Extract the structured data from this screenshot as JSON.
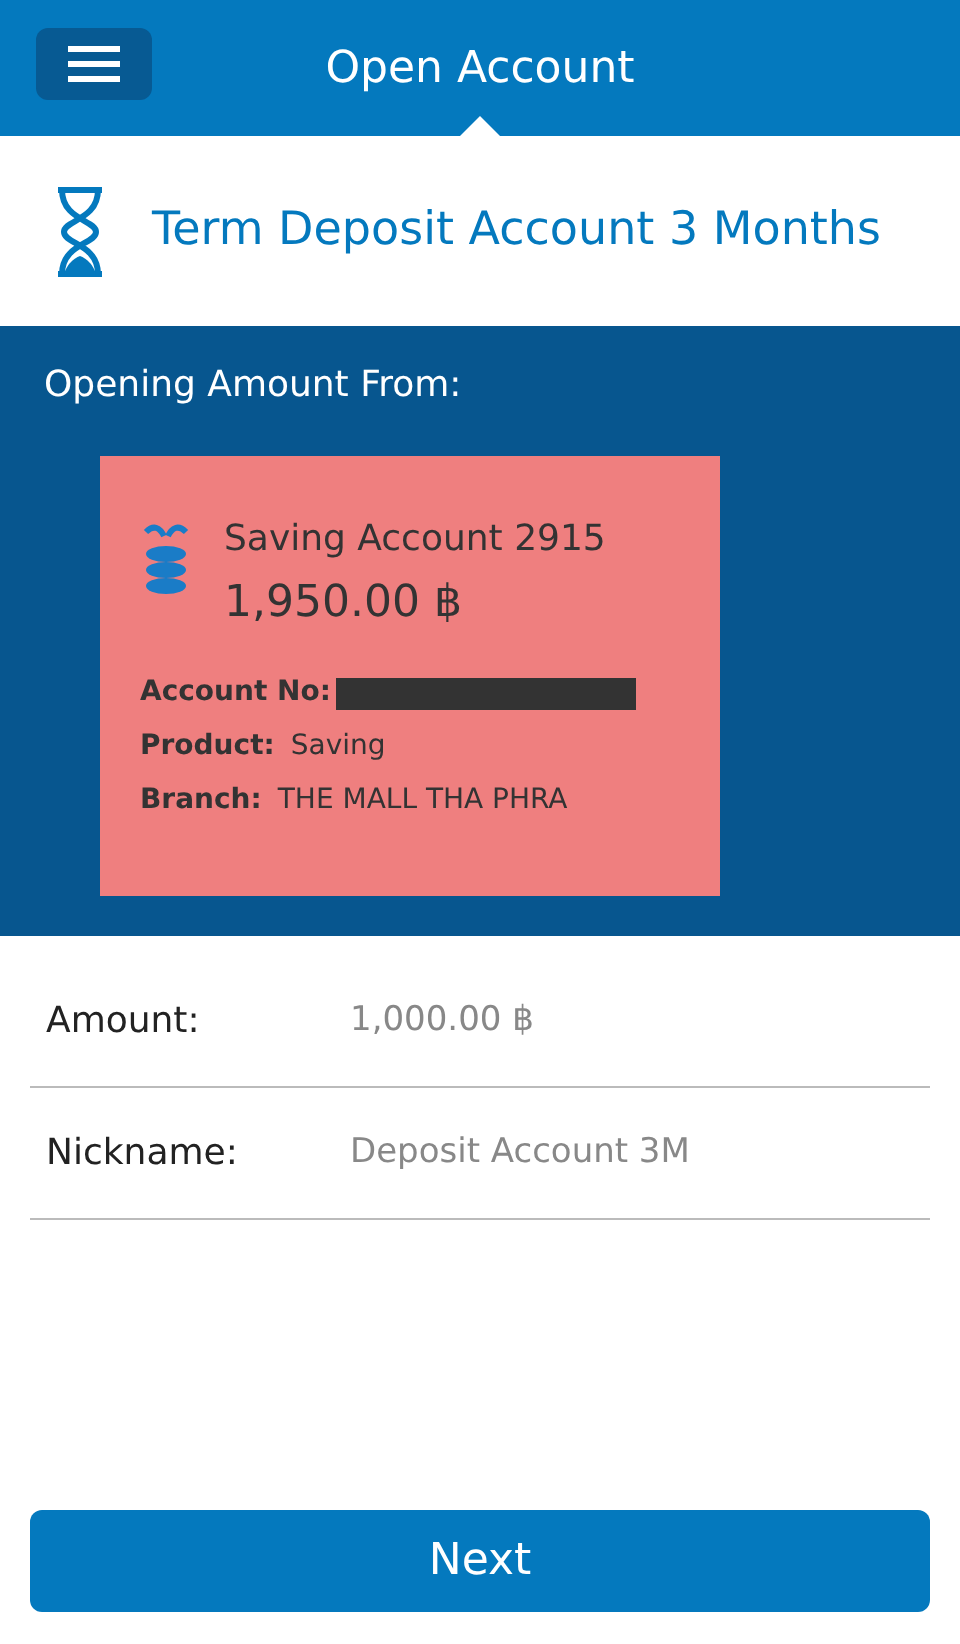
{
  "header": {
    "title": "Open Account"
  },
  "product": {
    "title": "Term Deposit Account 3 Months"
  },
  "source": {
    "label": "Opening Amount From:",
    "account": {
      "name": "Saving Account 2915",
      "balance": "1,950.00 ฿",
      "account_no_label": "Account No:",
      "account_no_redacted": true,
      "product_label": "Product:",
      "product": "Saving",
      "branch_label": "Branch:",
      "branch": "THE MALL THA PHRA"
    }
  },
  "fields": [
    {
      "label": "Amount:",
      "value": "1,000.00 ฿"
    },
    {
      "label": "Nickname:",
      "value": "Deposit Account 3M"
    }
  ],
  "buttons": [
    {
      "label": "Next"
    }
  ]
}
